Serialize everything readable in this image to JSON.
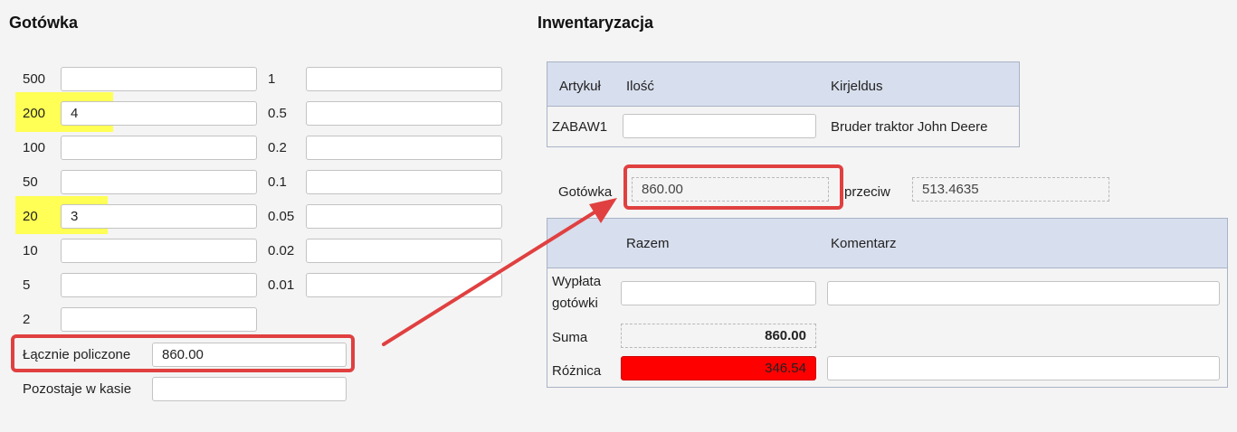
{
  "cash": {
    "title": "Gotówka",
    "denominations_left": [
      {
        "label": "500",
        "value": ""
      },
      {
        "label": "200",
        "value": "4"
      },
      {
        "label": "100",
        "value": ""
      },
      {
        "label": "50",
        "value": ""
      },
      {
        "label": "20",
        "value": "3"
      },
      {
        "label": "10",
        "value": ""
      },
      {
        "label": "5",
        "value": ""
      },
      {
        "label": "2",
        "value": ""
      }
    ],
    "denominations_right": [
      {
        "label": "1",
        "value": ""
      },
      {
        "label": "0.5",
        "value": ""
      },
      {
        "label": "0.2",
        "value": ""
      },
      {
        "label": "0.1",
        "value": ""
      },
      {
        "label": "0.05",
        "value": ""
      },
      {
        "label": "0.02",
        "value": ""
      },
      {
        "label": "0.01",
        "value": ""
      }
    ],
    "total_counted_label": "Łącznie policzone",
    "total_counted_value": "860.00",
    "remaining_label": "Pozostaje w kasie",
    "remaining_value": ""
  },
  "inventory": {
    "title": "Inwentaryzacja",
    "table_headers": {
      "article": "Artykuł",
      "quantity": "Ilość",
      "description": "Kirjeldus"
    },
    "rows": [
      {
        "article": "ZABAW1",
        "quantity": "",
        "description": "Bruder traktor John Deere"
      }
    ],
    "cash_label": "Gotówka",
    "cash_value": "860.00",
    "versus_label": "przeciw",
    "versus_value": "513.4635"
  },
  "summary": {
    "header_total": "Razem",
    "header_comment": "Komentarz",
    "payout_label_line1": "Wypłata",
    "payout_label_line2": "gotówki",
    "payout_value": "",
    "payout_comment": "",
    "sum_label": "Suma",
    "sum_value": "860.00",
    "difference_label": "Różnica",
    "difference_value": "346.54",
    "difference_comment": ""
  },
  "colors": {
    "highlight": "#ffff55",
    "annotation": "#e04040",
    "difference_bg": "#ff0000",
    "table_header_bg": "#d7deed"
  }
}
